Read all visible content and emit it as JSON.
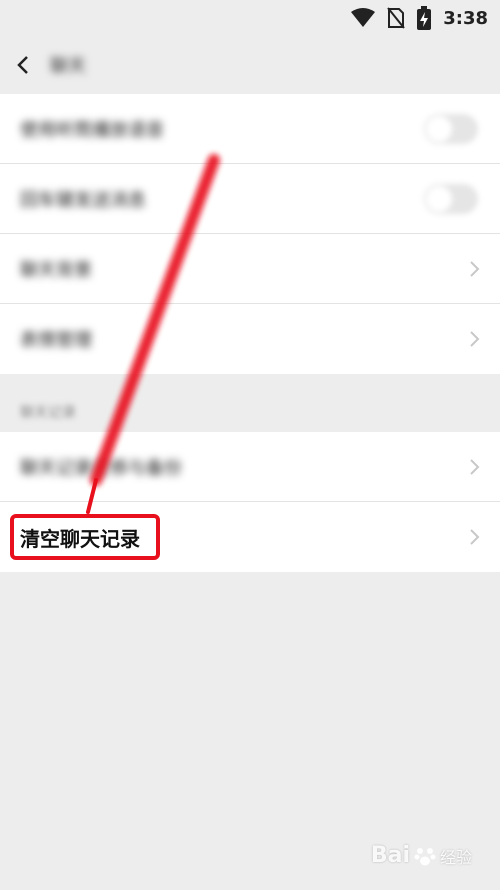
{
  "status_bar": {
    "time": "3:38",
    "icons": [
      "wifi-icon",
      "no-sim-icon",
      "battery-charging-icon"
    ]
  },
  "nav": {
    "back_icon": "back-chevron-icon",
    "title": "聊天"
  },
  "group1": {
    "items": [
      {
        "label": "使用听筒播放语音",
        "control": "toggle",
        "toggle_state": "off"
      },
      {
        "label": "回车键发送消息",
        "control": "toggle",
        "toggle_state": "off"
      },
      {
        "label": "聊天背景",
        "control": "chevron"
      },
      {
        "label": "表情管理",
        "control": "chevron"
      }
    ]
  },
  "section_header": "聊天记录",
  "group2": {
    "items": [
      {
        "label": "聊天记录迁移与备份",
        "control": "chevron"
      },
      {
        "label": "清空聊天记录",
        "control": "chevron"
      }
    ]
  },
  "annotation": {
    "highlight_color": "#e8101c"
  },
  "watermark": {
    "brand": "Bai",
    "suffix": "经验"
  }
}
